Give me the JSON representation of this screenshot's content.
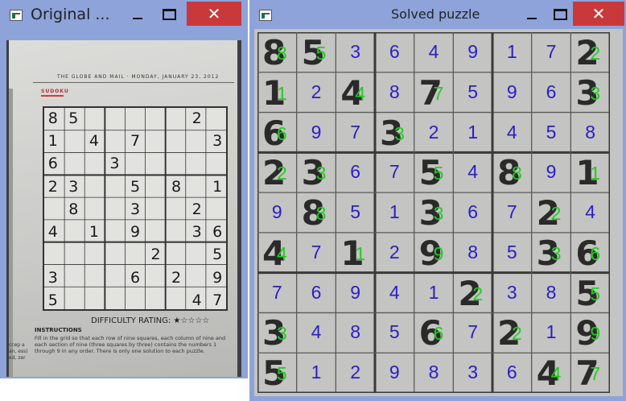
{
  "original_window": {
    "title": "Original ...",
    "close_label": "✕",
    "image": {
      "header": "THE GLOBE AND MAIL · MONDAY, JANUARY 23, 2012",
      "section_label": "SUDOKU",
      "grid": [
        [
          "8",
          "5",
          "",
          "",
          "",
          "",
          "",
          "2",
          ""
        ],
        [
          "1",
          "",
          "4",
          "",
          "7",
          "",
          "",
          "",
          "3"
        ],
        [
          "6",
          "",
          "",
          "3",
          "",
          "",
          "",
          "",
          ""
        ],
        [
          "2",
          "3",
          "",
          "",
          "5",
          "",
          "8",
          "",
          "1"
        ],
        [
          "",
          "8",
          "",
          "",
          "3",
          "",
          "",
          "2",
          ""
        ],
        [
          "4",
          "",
          "1",
          "",
          "9",
          "",
          "",
          "3",
          "6"
        ],
        [
          "",
          "",
          "",
          "",
          "",
          "2",
          "",
          "",
          "5"
        ],
        [
          "3",
          "",
          "",
          "",
          "6",
          "",
          "2",
          "",
          "9"
        ],
        [
          "5",
          "",
          "",
          "",
          "",
          "",
          "",
          "4",
          "7"
        ]
      ],
      "difficulty": "DIFFICULTY RATING: ★☆☆☆☆",
      "instructions_title": "INSTRUCTIONS",
      "instructions_text": "Fill in the grid so that each row of nine squares, each column of nine and each section of nine (three squares by three) contains the numbers 1 through 9 in any order. There is only one solution to each puzzle.",
      "margin_text": "ccep a an, ess) ed, zer"
    }
  },
  "solved_window": {
    "title": "Solved puzzle",
    "close_label": "✕",
    "given": [
      [
        "8",
        "5",
        "",
        "",
        "",
        "",
        "",
        "",
        "2"
      ],
      [
        "1",
        "",
        "4",
        "",
        "7",
        "",
        "",
        "",
        "3"
      ],
      [
        "6",
        "",
        "",
        "3",
        "",
        "",
        "",
        "",
        ""
      ],
      [
        "2",
        "3",
        "",
        "",
        "5",
        "",
        "8",
        "",
        "1"
      ],
      [
        "",
        "8",
        "",
        "",
        "3",
        "",
        "",
        "2",
        ""
      ],
      [
        "4",
        "",
        "1",
        "",
        "9",
        "",
        "",
        "3",
        "6"
      ],
      [
        "",
        "",
        "",
        "",
        "",
        "2",
        "",
        "",
        "5"
      ],
      [
        "3",
        "",
        "",
        "",
        "6",
        "",
        "2",
        "",
        "9"
      ],
      [
        "5",
        "",
        "",
        "",
        "",
        "",
        "",
        "4",
        "7"
      ]
    ],
    "solution": [
      [
        "8",
        "5",
        "3",
        "6",
        "4",
        "9",
        "1",
        "7",
        "2"
      ],
      [
        "1",
        "2",
        "4",
        "8",
        "7",
        "5",
        "9",
        "6",
        "3"
      ],
      [
        "6",
        "9",
        "7",
        "3",
        "2",
        "1",
        "4",
        "5",
        "8"
      ],
      [
        "2",
        "3",
        "6",
        "7",
        "5",
        "4",
        "8",
        "9",
        "1"
      ],
      [
        "9",
        "8",
        "5",
        "1",
        "3",
        "6",
        "7",
        "2",
        "4"
      ],
      [
        "4",
        "7",
        "1",
        "2",
        "9",
        "8",
        "5",
        "3",
        "6"
      ],
      [
        "7",
        "6",
        "9",
        "4",
        "1",
        "2",
        "3",
        "8",
        "5"
      ],
      [
        "3",
        "4",
        "8",
        "5",
        "6",
        "7",
        "2",
        "1",
        "9"
      ],
      [
        "5",
        "1",
        "2",
        "9",
        "8",
        "3",
        "6",
        "4",
        "7"
      ]
    ],
    "colors": {
      "solved_digit": "#2a1ec8",
      "overlay_digit": "#22cc22",
      "printed_digit": "#2a2a2a"
    }
  },
  "theme": {
    "window_frame": "#8ea3d9",
    "close_button": "#c9393c"
  }
}
